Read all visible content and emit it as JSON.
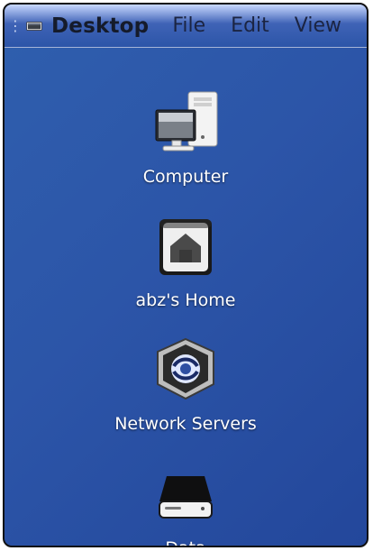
{
  "menubar": {
    "app_label": "Desktop",
    "menus": [
      "File",
      "Edit",
      "View"
    ],
    "handle_icon": "grip-icon",
    "app_icon": "desktop-icon"
  },
  "desktop": {
    "items": [
      {
        "label": "Computer",
        "icon": "computer-icon"
      },
      {
        "label": "abz's Home",
        "icon": "home-folder-icon"
      },
      {
        "label": "Network Servers",
        "icon": "network-servers-icon"
      },
      {
        "label": "Data",
        "icon": "drive-icon"
      }
    ],
    "background_color": "#2c55a8"
  }
}
